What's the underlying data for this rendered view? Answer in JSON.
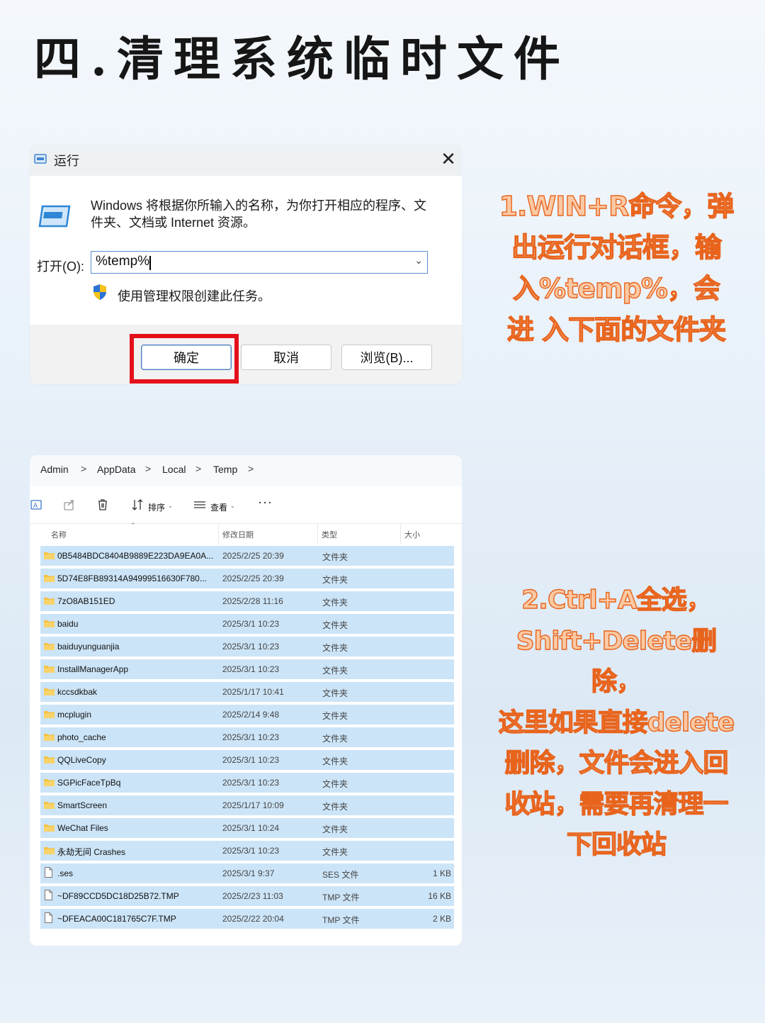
{
  "page_title": "四.清理系统临时文件",
  "run_dialog": {
    "title": "运行",
    "close_symbol": "✕",
    "description": "Windows 将根据你所输入的名称，为你打开相应的程序、文件夹、文档或 Internet 资源。",
    "open_label": "打开(O):",
    "open_value": "%temp%",
    "admin_text": "使用管理权限创建此任务。",
    "ok_label": "确定",
    "cancel_label": "取消",
    "browse_label": "浏览(B)..."
  },
  "explorer": {
    "breadcrumbs": [
      "Admin",
      "AppData",
      "Local",
      "Temp"
    ],
    "breadcrumb_sep": ">",
    "toolbar": {
      "sort_label": "排序",
      "view_label": "查看",
      "more_label": "···"
    },
    "columns": {
      "name": "名称",
      "date": "修改日期",
      "type": "类型",
      "size": "大小"
    },
    "rows": [
      {
        "name": "0B5484BDC8404B9889E223DA9EA0A...",
        "date": "2025/2/25 20:39",
        "type": "文件夹",
        "size": "",
        "kind": "folder"
      },
      {
        "name": "5D74E8FB89314A94999516630F780...",
        "date": "2025/2/25 20:39",
        "type": "文件夹",
        "size": "",
        "kind": "folder"
      },
      {
        "name": "7zO8AB151ED",
        "date": "2025/2/28 11:16",
        "type": "文件夹",
        "size": "",
        "kind": "folder"
      },
      {
        "name": "baidu",
        "date": "2025/3/1 10:23",
        "type": "文件夹",
        "size": "",
        "kind": "folder"
      },
      {
        "name": "baiduyunguanjia",
        "date": "2025/3/1 10:23",
        "type": "文件夹",
        "size": "",
        "kind": "folder"
      },
      {
        "name": "InstallManagerApp",
        "date": "2025/3/1 10:23",
        "type": "文件夹",
        "size": "",
        "kind": "folder"
      },
      {
        "name": "kccsdkbak",
        "date": "2025/1/17 10:41",
        "type": "文件夹",
        "size": "",
        "kind": "folder"
      },
      {
        "name": "mcplugin",
        "date": "2025/2/14 9:48",
        "type": "文件夹",
        "size": "",
        "kind": "folder"
      },
      {
        "name": "photo_cache",
        "date": "2025/3/1 10:23",
        "type": "文件夹",
        "size": "",
        "kind": "folder"
      },
      {
        "name": "QQLiveCopy",
        "date": "2025/3/1 10:23",
        "type": "文件夹",
        "size": "",
        "kind": "folder"
      },
      {
        "name": "SGPicFaceTpBq",
        "date": "2025/3/1 10:23",
        "type": "文件夹",
        "size": "",
        "kind": "folder"
      },
      {
        "name": "SmartScreen",
        "date": "2025/1/17 10:09",
        "type": "文件夹",
        "size": "",
        "kind": "folder"
      },
      {
        "name": "WeChat Files",
        "date": "2025/3/1 10:24",
        "type": "文件夹",
        "size": "",
        "kind": "folder"
      },
      {
        "name": "永劫无间 Crashes",
        "date": "2025/3/1 10:23",
        "type": "文件夹",
        "size": "",
        "kind": "folder"
      },
      {
        "name": ".ses",
        "date": "2025/3/1 9:37",
        "type": "SES 文件",
        "size": "1 KB",
        "kind": "file"
      },
      {
        "name": "~DF89CCD5DC18D25B72.TMP",
        "date": "2025/2/23 11:03",
        "type": "TMP 文件",
        "size": "16 KB",
        "kind": "file"
      },
      {
        "name": "~DFEACA00C181765C7F.TMP",
        "date": "2025/2/22 20:04",
        "type": "TMP 文件",
        "size": "2 KB",
        "kind": "file"
      }
    ]
  },
  "notes": {
    "step1": [
      "1.WIN+R命令，弹",
      "出运行对话框，输",
      "入%temp%，会",
      "进 入下面的文件夹"
    ],
    "step2": [
      "2.Ctrl+A全选，",
      "Shift+Delete删除，",
      "这里如果直接delete",
      "删除，文件会进入回",
      "收站，需要再清理一",
      "下回收站"
    ]
  },
  "colors": {
    "highlight": "#e3101b",
    "row_selected": "#cce4f7",
    "note_fill": "#fbc9a3",
    "note_stroke": "#e8641d",
    "folder": "#f5c242"
  }
}
